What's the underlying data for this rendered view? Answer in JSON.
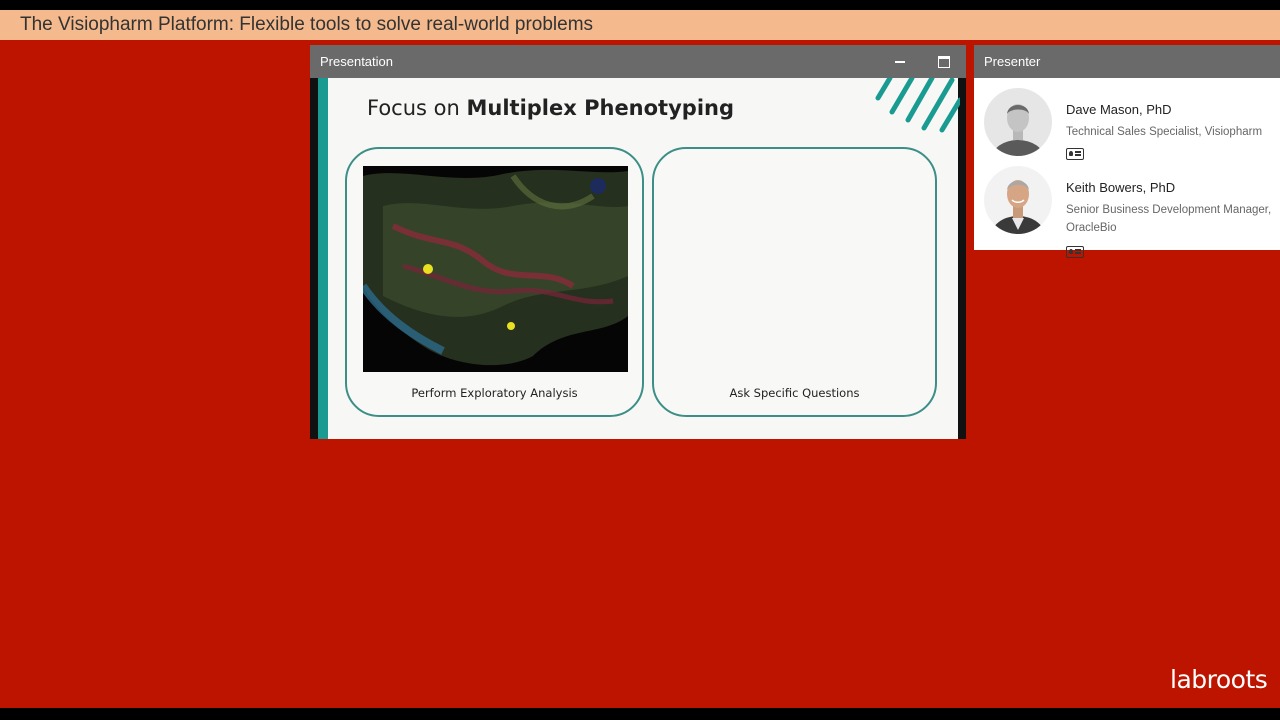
{
  "page": {
    "title": "The Visiopharm Platform: Flexible tools to solve real-world problems"
  },
  "presentation": {
    "header": "Presentation",
    "slide": {
      "title_prefix": "Focus on ",
      "title_bold": "Multiplex Phenotyping",
      "cards": [
        {
          "label": "Perform Exploratory Analysis"
        },
        {
          "label": "Ask Specific Questions"
        }
      ]
    }
  },
  "presenter": {
    "header": "Presenter",
    "people": [
      {
        "name": "Dave Mason, PhD",
        "role_lines": [
          "Technical Sales Specialist, Visiopharm"
        ]
      },
      {
        "name": "Keith Bowers, PhD",
        "role_lines": [
          "Senior Business Development Manager,",
          "OracleBio"
        ]
      }
    ]
  },
  "branding": {
    "logo_text": "labroots"
  },
  "colors": {
    "background": "#bd1400",
    "title_bar": "#f4b98c",
    "window_header": "#6a6a6a",
    "teal_accent": "#1a9b91"
  },
  "icons": {
    "minimize": "minimize-icon",
    "maximize": "maximize-icon",
    "contact_card": "contact-card-icon"
  }
}
